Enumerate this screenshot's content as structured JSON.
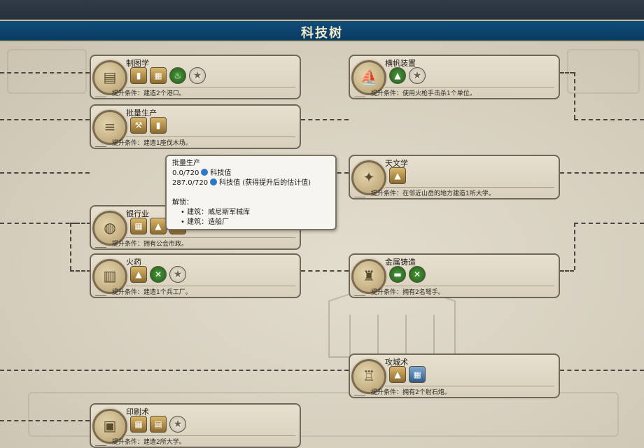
{
  "title": "科技树",
  "tooltip": {
    "name": "批量生产",
    "progress": "0.0/720",
    "progress_unit": "科技值",
    "estimated": "287.0/720",
    "estimated_unit": "科技值 (获得提升后的估计值)",
    "unlocks_label": "解锁：",
    "unlocks": [
      "建筑：威尼斯军械库",
      "建筑：造船厂"
    ]
  },
  "nodes": [
    {
      "name": "制图学",
      "condition": "提升条件：建造2个港口。",
      "icon": "map-icon",
      "unlock_icons": [
        "building",
        "building",
        "green",
        "star"
      ]
    },
    {
      "name": "批量生产",
      "condition": "提升条件：建造1座伐木场。",
      "icon": "logs-icon",
      "unlock_icons": [
        "building",
        "building"
      ]
    },
    {
      "name": "银行业",
      "condition": "提升条件：拥有公会市政。",
      "icon": "coins-icon",
      "unlock_icons": [
        "building",
        "building",
        "building"
      ]
    },
    {
      "name": "火药",
      "condition": "提升条件：建造1个兵工厂。",
      "icon": "barrel-icon",
      "unlock_icons": [
        "building",
        "green",
        "star"
      ]
    },
    {
      "name": "印刷术",
      "condition": "提升条件：建造2所大学。",
      "icon": "press-icon",
      "unlock_icons": [
        "building",
        "building",
        "star"
      ]
    },
    {
      "name": "横帆装置",
      "condition": "提升条件：使用火枪手击杀1个单位。",
      "icon": "ship-icon",
      "unlock_icons": [
        "green",
        "star"
      ]
    },
    {
      "name": "天文学",
      "condition": "提升条件：在邻近山岳的地方建造1所大学。",
      "icon": "telescope-icon",
      "unlock_icons": [
        "building"
      ]
    },
    {
      "name": "金属铸造",
      "condition": "提升条件：拥有2名弩手。",
      "icon": "foundry-icon",
      "unlock_icons": [
        "green",
        "green"
      ]
    },
    {
      "name": "攻城术",
      "condition": "提升条件：拥有2个射石炮。",
      "icon": "siege-icon",
      "unlock_icons": [
        "building",
        "blue"
      ]
    }
  ]
}
